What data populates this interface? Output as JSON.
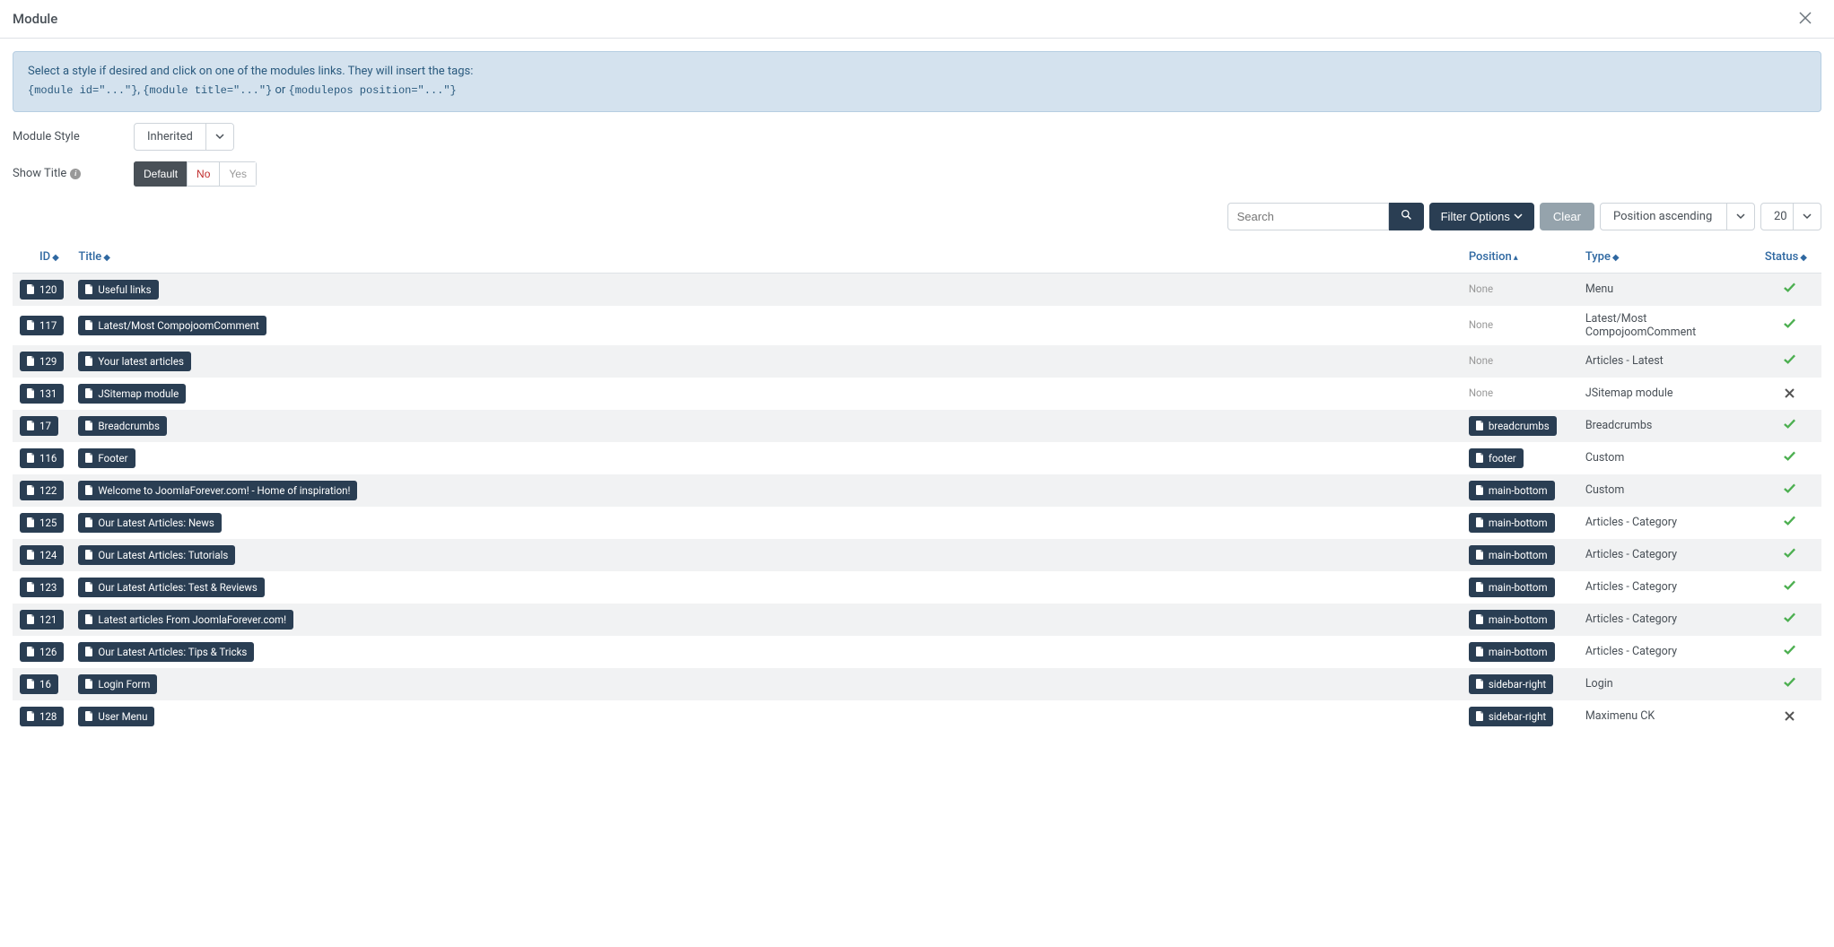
{
  "modal": {
    "title": "Module"
  },
  "alert": {
    "text_before": "Select a style if desired and click on one of the modules links. They will insert the tags:",
    "code1": "{module id=\"...\"}",
    "sep1": ", ",
    "code2": "{module title=\"...\"}",
    "sep2": " or ",
    "code3": "{modulepos position=\"...\"}"
  },
  "form": {
    "style_label": "Module Style",
    "style_value": "Inherited",
    "show_title_label": "Show Title",
    "show_title_default": "Default",
    "show_title_no": "No",
    "show_title_yes": "Yes"
  },
  "filters": {
    "search_placeholder": "Search",
    "filter_options": "Filter Options",
    "clear": "Clear",
    "sort_value": "Position ascending",
    "limit_value": "20"
  },
  "table": {
    "headers": {
      "id": "ID",
      "title": "Title",
      "position": "Position",
      "type": "Type",
      "status": "Status"
    },
    "rows": [
      {
        "id": "120",
        "title": "Useful links",
        "position": null,
        "type": "Menu",
        "status": true
      },
      {
        "id": "117",
        "title": "Latest/Most CompojoomComment",
        "position": null,
        "type": "Latest/Most CompojoomComment",
        "status": true
      },
      {
        "id": "129",
        "title": "Your latest articles",
        "position": null,
        "type": "Articles - Latest",
        "status": true
      },
      {
        "id": "131",
        "title": "JSitemap module",
        "position": null,
        "type": "JSitemap module",
        "status": false
      },
      {
        "id": "17",
        "title": "Breadcrumbs",
        "position": "breadcrumbs",
        "type": "Breadcrumbs",
        "status": true
      },
      {
        "id": "116",
        "title": "Footer",
        "position": "footer",
        "type": "Custom",
        "status": true
      },
      {
        "id": "122",
        "title": "Welcome to JoomlaForever.com! - Home of inspiration!",
        "position": "main-bottom",
        "type": "Custom",
        "status": true
      },
      {
        "id": "125",
        "title": "Our Latest Articles: News",
        "position": "main-bottom",
        "type": "Articles - Category",
        "status": true
      },
      {
        "id": "124",
        "title": "Our Latest Articles: Tutorials",
        "position": "main-bottom",
        "type": "Articles - Category",
        "status": true
      },
      {
        "id": "123",
        "title": "Our Latest Articles: Test & Reviews",
        "position": "main-bottom",
        "type": "Articles - Category",
        "status": true
      },
      {
        "id": "121",
        "title": "Latest articles From JoomlaForever.com!",
        "position": "main-bottom",
        "type": "Articles - Category",
        "status": true
      },
      {
        "id": "126",
        "title": "Our Latest Articles: Tips & Tricks",
        "position": "main-bottom",
        "type": "Articles - Category",
        "status": true
      },
      {
        "id": "16",
        "title": "Login Form",
        "position": "sidebar-right",
        "type": "Login",
        "status": true
      },
      {
        "id": "128",
        "title": "User Menu",
        "position": "sidebar-right",
        "type": "Maximenu CK",
        "status": false
      }
    ],
    "none_text": "None"
  }
}
